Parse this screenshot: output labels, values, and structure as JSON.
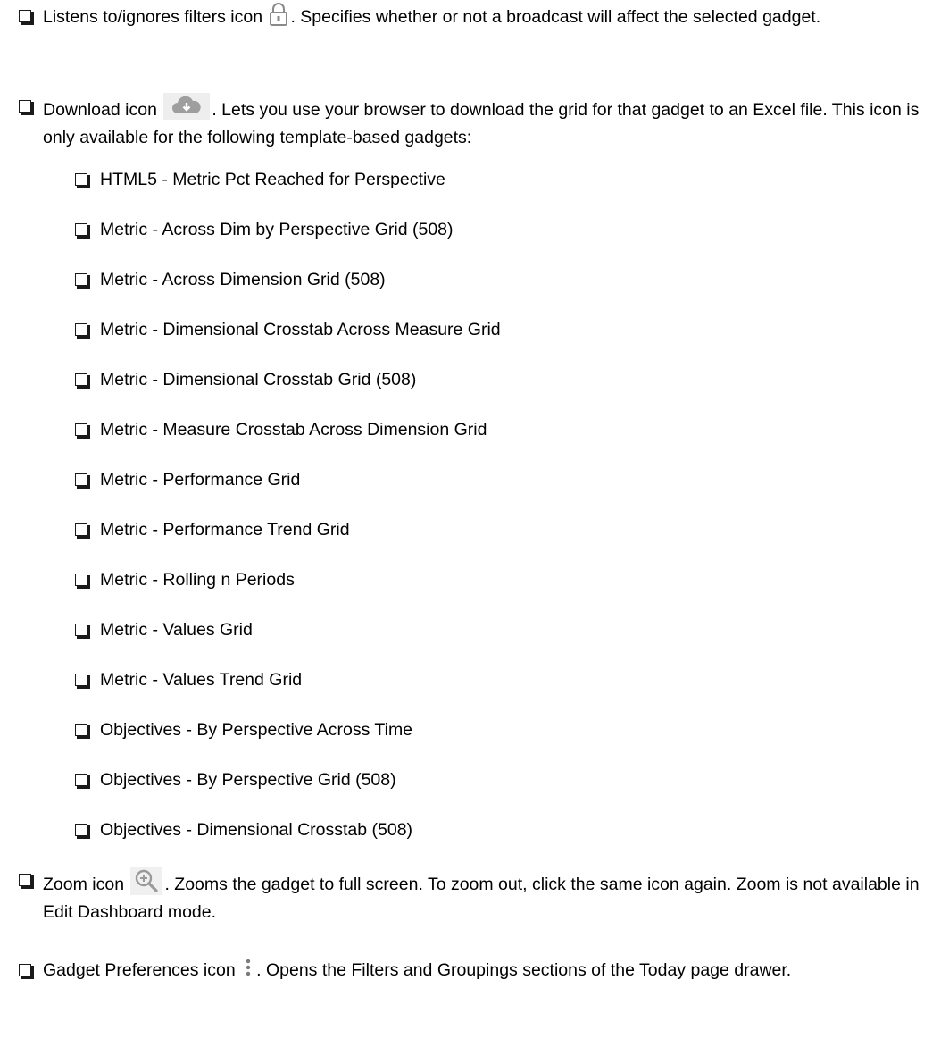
{
  "items": [
    {
      "pre": "Listens to/ignores filters icon",
      "post": ". Specifies whether or not a broadcast will affect the selected gadget.",
      "icon": "lock-icon"
    },
    {
      "pre": "Download icon",
      "post": ". Lets you use your browser to download the grid for that gadget to an Excel file. This icon is only available for the following template-based gadgets:",
      "icon": "download-cloud-icon"
    },
    {
      "pre": "Zoom icon",
      "post": ". Zooms the gadget to full screen. To zoom out, click the same icon again. Zoom is not available in Edit Dashboard mode.",
      "icon": "zoom-in-icon"
    },
    {
      "pre": "Gadget Preferences icon",
      "post": ". Opens the Filters and Groupings sections of the Today page drawer.",
      "icon": "vertical-ellipsis-icon"
    }
  ],
  "sub_items": [
    "HTML5 - Metric Pct Reached for Perspective",
    "Metric - Across Dim by Perspective Grid (508)",
    "Metric - Across Dimension Grid (508)",
    "Metric - Dimensional Crosstab Across Measure Grid",
    "Metric - Dimensional Crosstab Grid (508)",
    "Metric - Measure Crosstab Across Dimension Grid",
    "Metric - Performance Grid",
    "Metric - Performance Trend Grid",
    "Metric - Rolling n Periods",
    "Metric - Values Grid",
    "Metric - Values Trend Grid",
    "Objectives - By Perspective Across Time",
    "Objectives - By Perspective Grid (508)",
    "Objectives - Dimensional Crosstab (508)"
  ],
  "colors": {
    "text": "#000000",
    "bullet": "#1a1a1a",
    "icon_gray": "#9e9e9e",
    "icon_bg": "#eeeeee"
  }
}
